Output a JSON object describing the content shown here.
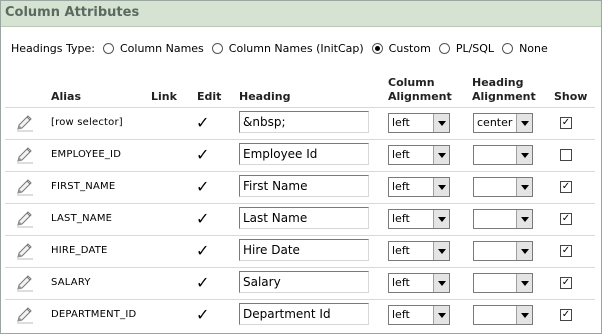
{
  "region": {
    "title": "Column Attributes"
  },
  "headings_type": {
    "label": "Headings Type:",
    "options": [
      {
        "label": "Column Names",
        "selected": false
      },
      {
        "label": "Column Names (InitCap)",
        "selected": false
      },
      {
        "label": "Custom",
        "selected": true
      },
      {
        "label": "PL/SQL",
        "selected": false
      },
      {
        "label": "None",
        "selected": false
      }
    ]
  },
  "table": {
    "headers": {
      "alias": "Alias",
      "link": "Link",
      "edit": "Edit",
      "heading": "Heading",
      "col_align_1": "Column",
      "col_align_2": "Alignment",
      "head_align_1": "Heading",
      "head_align_2": "Alignment",
      "show": "Show"
    },
    "rows": [
      {
        "alias": "[row selector]",
        "edit": "✓",
        "heading": "&nbsp;",
        "column_alignment": "left",
        "heading_alignment": "center",
        "show": "✓"
      },
      {
        "alias": "EMPLOYEE_ID",
        "edit": "✓",
        "heading": "Employee Id",
        "column_alignment": "left",
        "heading_alignment": "",
        "show": ""
      },
      {
        "alias": "FIRST_NAME",
        "edit": "✓",
        "heading": "First Name",
        "column_alignment": "left",
        "heading_alignment": "",
        "show": "✓"
      },
      {
        "alias": "LAST_NAME",
        "edit": "✓",
        "heading": "Last Name",
        "column_alignment": "left",
        "heading_alignment": "",
        "show": "✓"
      },
      {
        "alias": "HIRE_DATE",
        "edit": "✓",
        "heading": "Hire Date",
        "column_alignment": "left",
        "heading_alignment": "",
        "show": "✓"
      },
      {
        "alias": "SALARY",
        "edit": "✓",
        "heading": "Salary",
        "column_alignment": "left",
        "heading_alignment": "",
        "show": "✓"
      },
      {
        "alias": "DEPARTMENT_ID",
        "edit": "✓",
        "heading": "Department Id",
        "column_alignment": "left",
        "heading_alignment": "",
        "show": "✓"
      }
    ]
  },
  "icons": {
    "row_edit": "pencil-icon"
  },
  "colors": {
    "header_bg": "#d6e3d3",
    "header_text": "#5a6a5f"
  }
}
